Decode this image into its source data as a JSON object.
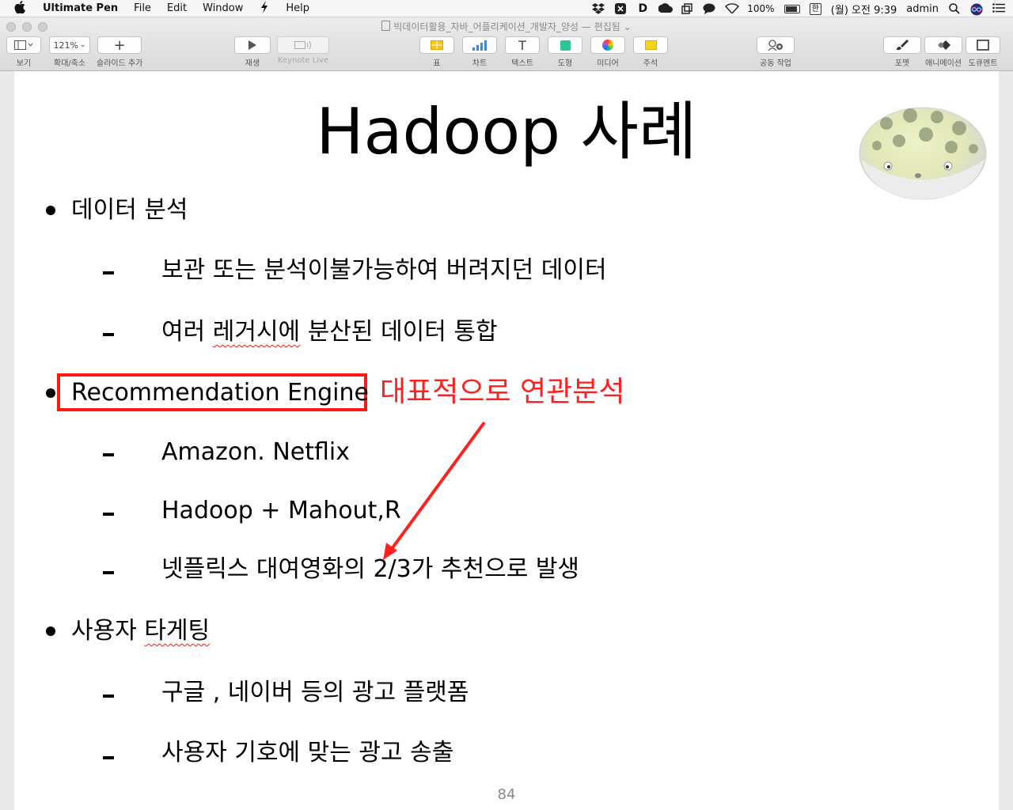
{
  "menubar": {
    "app_name": "Ultimate Pen",
    "items": [
      "File",
      "Edit",
      "Window",
      "Help"
    ],
    "battery": "100%",
    "input_method": "한",
    "clock": "(월) 오전 9:39",
    "user": "admin"
  },
  "window": {
    "title": "빅데이터활용_자바_어플리케이션_개발자_양성",
    "title_status": "— 편집됨"
  },
  "toolbar": {
    "view_label": "보기",
    "zoom_value": "121%",
    "zoom_label": "확대/축소",
    "add_slide_label": "슬라이드 추가",
    "play_label": "재생",
    "keynote_live_label": "Keynote Live",
    "table_label": "표",
    "chart_label": "차트",
    "text_label": "텍스트",
    "text_icon_glyph": "T",
    "shape_label": "도형",
    "media_label": "미디어",
    "comment_label": "주석",
    "collaborate_label": "공동 작업",
    "format_label": "포맷",
    "animate_label": "애니메이션",
    "document_label": "도큐멘트"
  },
  "slide": {
    "title": "Hadoop 사례",
    "bullets": [
      {
        "text": "데이터 분석",
        "subs": [
          "보관 또는 분석이불가능하여 버려지던 데이터",
          "여러 레거시에 분산된 데이터 통합"
        ]
      },
      {
        "text": "Recommendation Engine",
        "subs": [
          "Amazon. Netflix",
          "Hadoop + Mahout,R",
          "넷플릭스 대여영화의 2/3가 추천으로 발생"
        ]
      },
      {
        "text": "사용자 타게팅",
        "subs": [
          "구글 ,  네이버 등의 광고 플랫폼",
          "사용자 기호에 맞는 광고 송출"
        ]
      }
    ],
    "sub_word_legacy_prefix": "여러 ",
    "sub_word_legacy": "레거시에",
    "sub_word_legacy_suffix": " 분산된 데이터 통합",
    "bullet3_prefix": "사용자 ",
    "bullet3_word": "타게팅",
    "annotation": "대표적으로 연관분석",
    "page_number": "84"
  },
  "colors": {
    "annotation_red": "#ff2020",
    "slide_bg": "#ffffff",
    "canvas_bg": "#e9e9e9"
  }
}
